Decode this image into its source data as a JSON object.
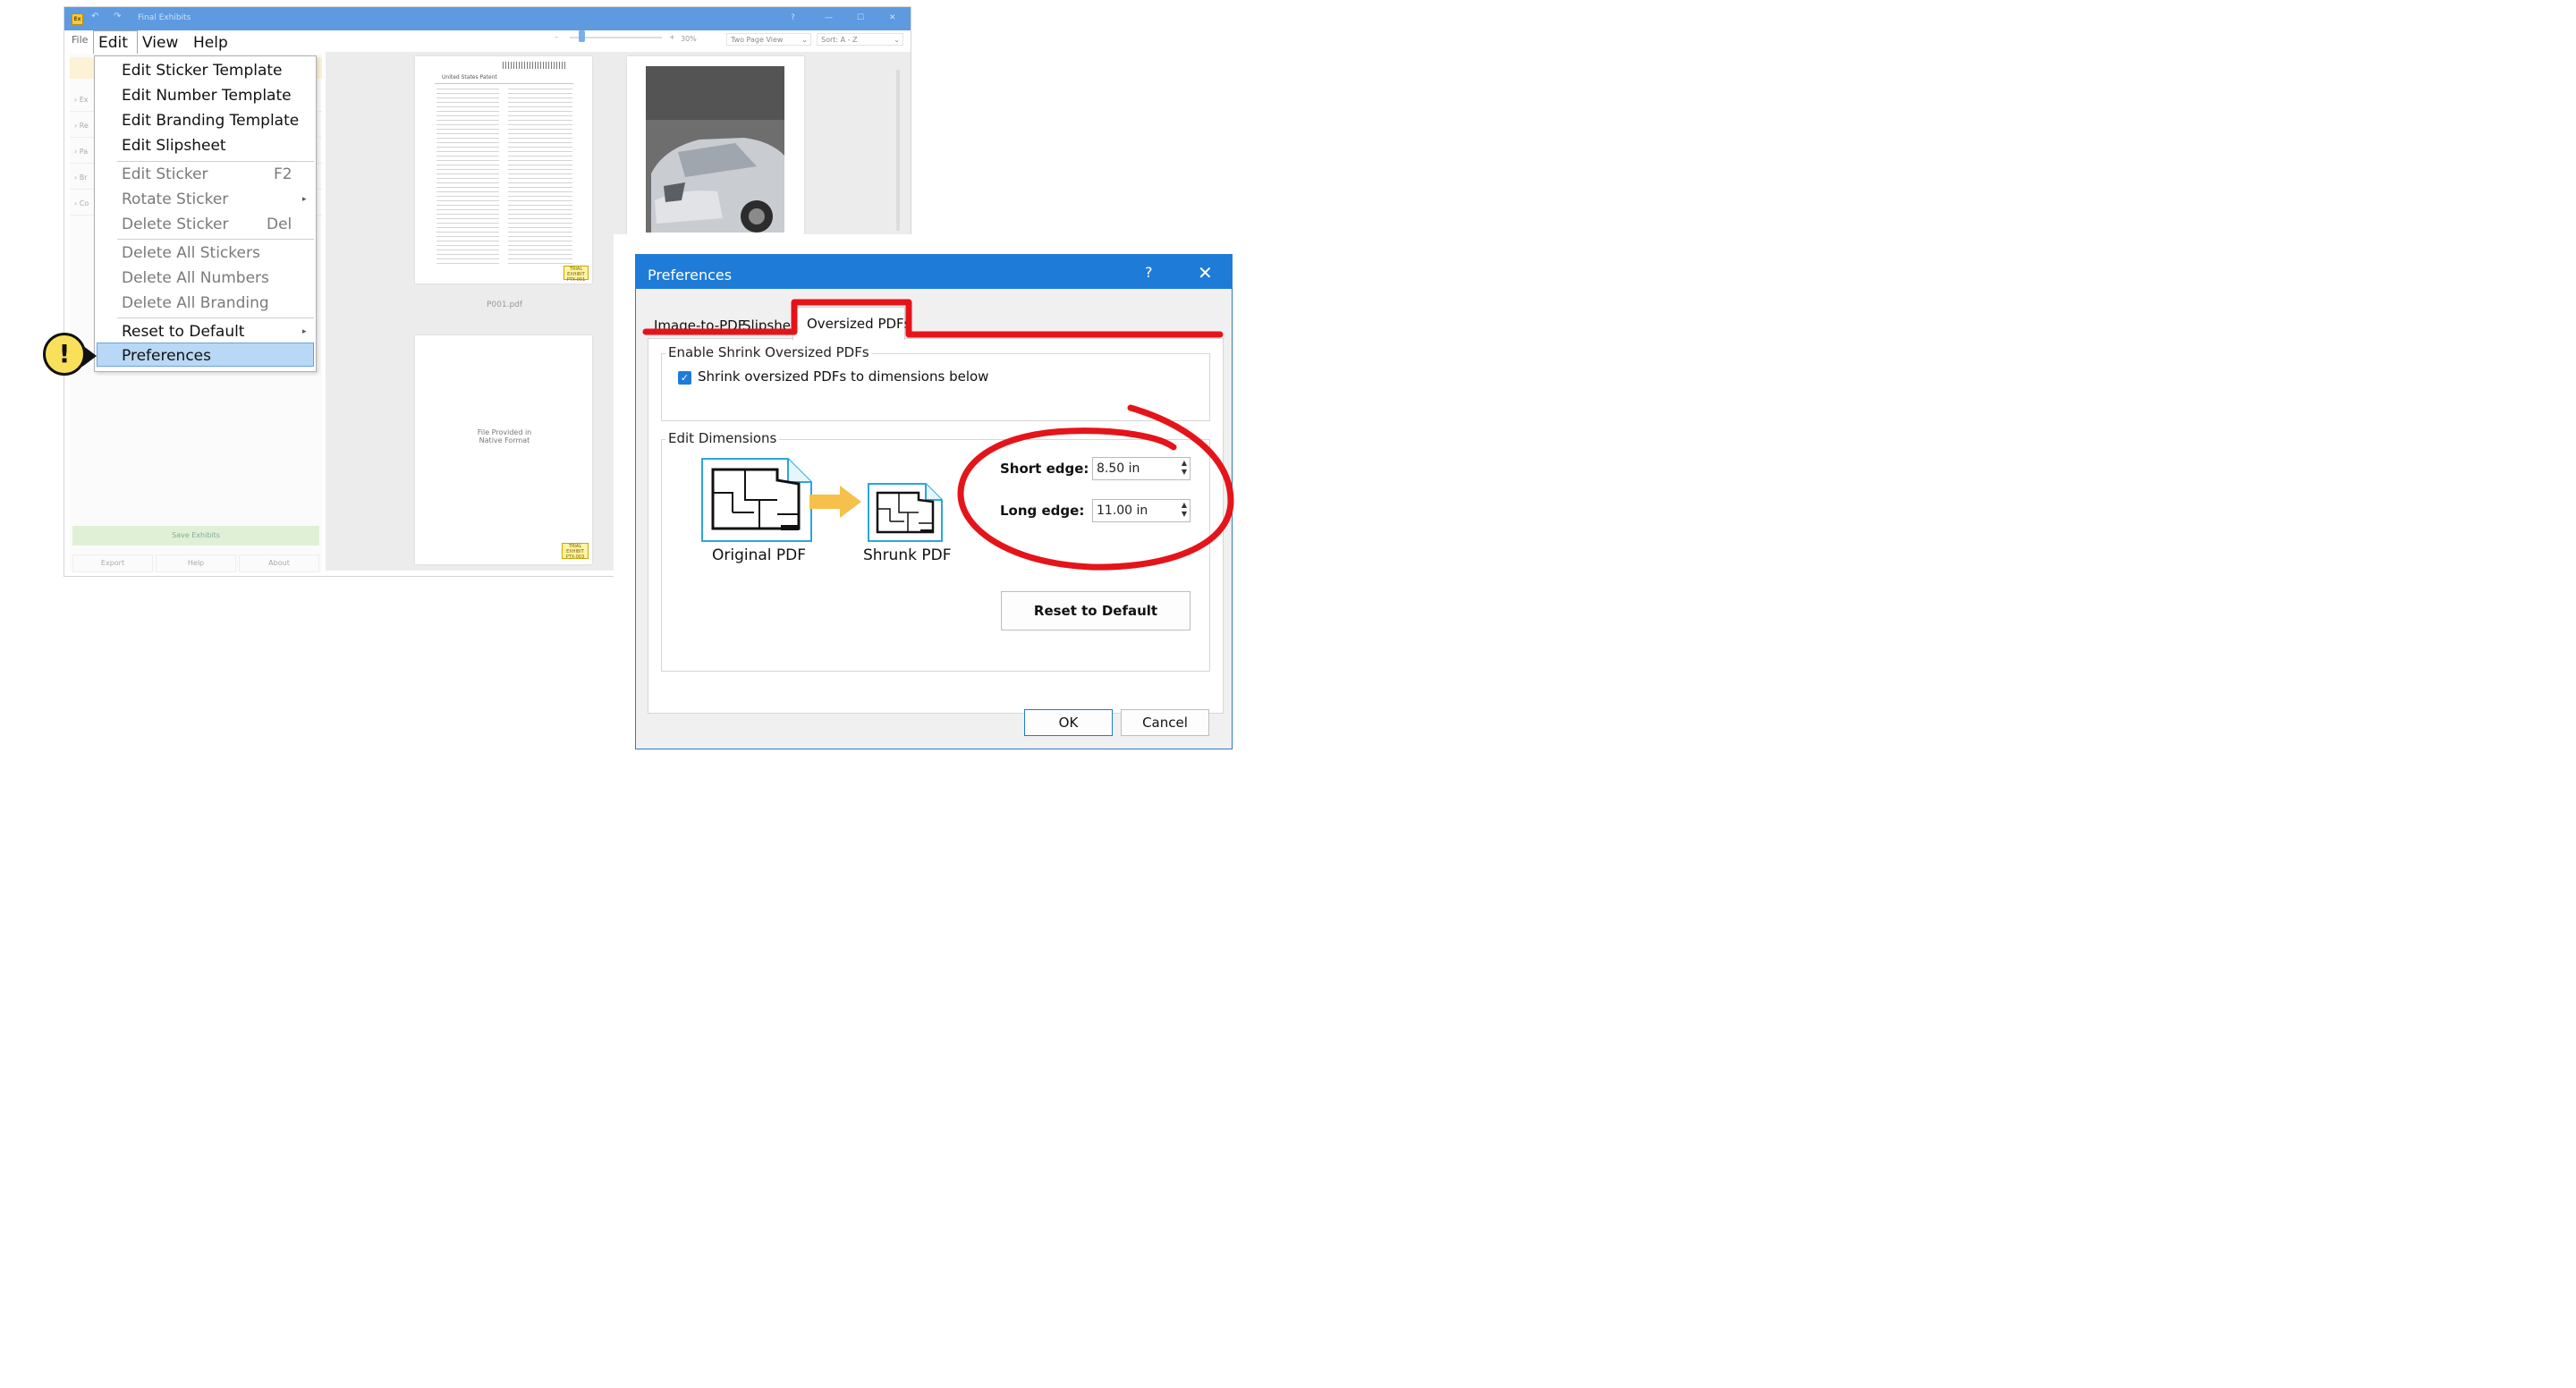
{
  "app": {
    "title": "Final Exhibits",
    "icon_text": "Ex",
    "help_glyph": "?",
    "menu": {
      "file": "File",
      "edit": "Edit",
      "view": "View",
      "help": "Help"
    },
    "zoom": {
      "minus": "–",
      "plus": "+",
      "value": "30%"
    },
    "view_mode": "Two Page View",
    "sort": "Sort: A - Z",
    "left_rows": [
      "Ex",
      "Re",
      "Pa",
      "Br",
      "Co"
    ],
    "save_button": "Save Exhibits",
    "footer_buttons": [
      "Export",
      "Help",
      "About"
    ],
    "preview": {
      "page1_heading": "United States Patent",
      "page1_filename": "P001.pdf",
      "page1_sticker": "PTX-001",
      "page2_text": "File Provided in Native Format",
      "page2_sticker": "PTX-003",
      "sticker_caption": "TRIAL EXHIBIT"
    }
  },
  "edit_menu": {
    "items": [
      {
        "label": "Edit Sticker Template",
        "enabled": true
      },
      {
        "label": "Edit Number Template",
        "enabled": true
      },
      {
        "label": "Edit Branding Template",
        "enabled": true
      },
      {
        "label": "Edit Slipsheet",
        "enabled": true
      },
      {
        "label": "Edit Sticker",
        "shortcut": "F2",
        "enabled": false
      },
      {
        "label": "Rotate Sticker",
        "submenu": true,
        "enabled": false
      },
      {
        "label": "Delete Sticker",
        "shortcut": "Del",
        "enabled": false
      },
      {
        "label": "Delete All Stickers",
        "enabled": false
      },
      {
        "label": "Delete All Numbers",
        "enabled": false
      },
      {
        "label": "Delete All Branding",
        "enabled": false
      },
      {
        "label": "Reset to Default",
        "submenu": true,
        "enabled": true
      },
      {
        "label": "Preferences",
        "enabled": true,
        "highlighted": true
      }
    ]
  },
  "callout": {
    "glyph": "!"
  },
  "dialog": {
    "title": "Preferences",
    "help_glyph": "?",
    "close_glyph": "✕",
    "tabs": [
      "Image-to-PDF",
      "Slipsheet",
      "Oversized PDFs"
    ],
    "active_tab": "Oversized PDFs",
    "enable_group": {
      "title": "Enable Shrink Oversized PDFs",
      "checkbox_label": "Shrink oversized PDFs to dimensions below",
      "checked": true
    },
    "dimensions_group": {
      "title": "Edit Dimensions",
      "original_label": "Original PDF",
      "shrunk_label": "Shrunk PDF",
      "short_edge_label": "Short edge:",
      "short_edge_value": "8.50 in",
      "long_edge_label": "Long edge:",
      "long_edge_value": "11.00 in",
      "reset_button": "Reset to Default"
    },
    "ok": "OK",
    "cancel": "Cancel"
  },
  "colors": {
    "accent": "#1e7bd8",
    "annotation": "#e5141a",
    "menu_highlight": "#b8d8f5",
    "callout": "#f9e05a"
  }
}
